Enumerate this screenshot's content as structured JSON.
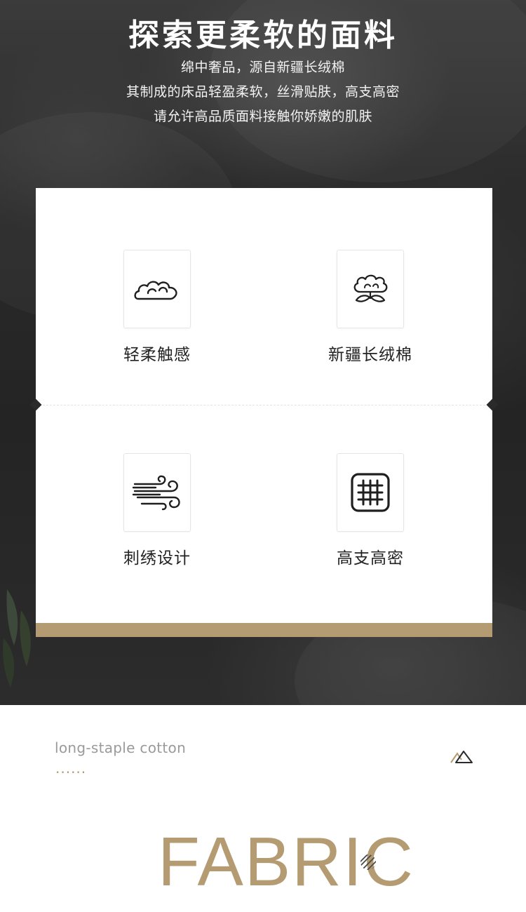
{
  "hero": {
    "title": "探索更柔软的面料",
    "lines": [
      "绵中奢品，源自新疆长绒棉",
      "其制成的床品轻盈柔软，丝滑贴肤，高支高密",
      "请允许高品质面料接触你娇嫩的肌肤"
    ]
  },
  "features": [
    {
      "label": "轻柔触感",
      "icon": "cloud-icon"
    },
    {
      "label": "新疆长绒棉",
      "icon": "cotton-flower-icon"
    },
    {
      "label": "刺绣设计",
      "icon": "wind-icon"
    },
    {
      "label": "高支高密",
      "icon": "grid-weave-icon"
    }
  ],
  "fabric": {
    "subtitle": "long-staple cotton",
    "dots": "......",
    "title": "FABRIC",
    "accent_icon": "mountain-icon"
  },
  "colors": {
    "gold": "#b59b71",
    "dark_background": "#2a2a2a",
    "card": "#ffffff"
  }
}
